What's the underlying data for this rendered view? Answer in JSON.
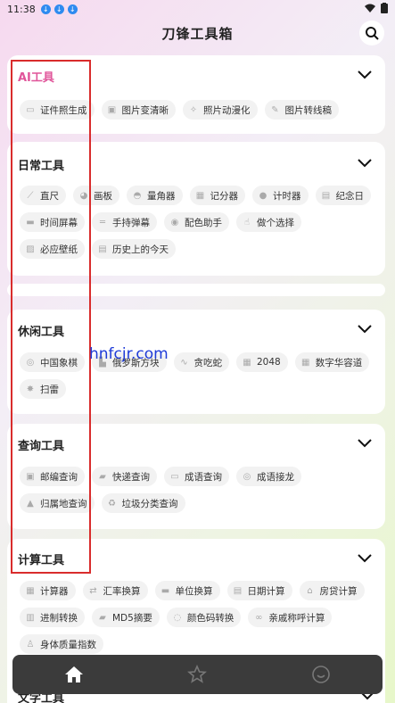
{
  "status_bar": {
    "time": "11:38"
  },
  "header": {
    "title": "刀锋工具箱"
  },
  "sections": [
    {
      "title": "AI工具",
      "items": [
        "证件照生成",
        "图片变清晰",
        "照片动漫化",
        "图片转线稿"
      ]
    },
    {
      "title": "日常工具",
      "items": [
        "直尺",
        "画板",
        "量角器",
        "记分器",
        "计时器",
        "纪念日",
        "时间屏幕",
        "手持弹幕",
        "配色助手",
        "做个选择",
        "必应壁纸",
        "历史上的今天"
      ]
    },
    {
      "title": "休闲工具",
      "items": [
        "中国象棋",
        "俄罗斯方块",
        "贪吃蛇",
        "2048",
        "数字华容道",
        "扫雷"
      ]
    },
    {
      "title": "查询工具",
      "items": [
        "邮编查询",
        "快递查询",
        "成语查询",
        "成语接龙",
        "归属地查询",
        "垃圾分类查询"
      ]
    },
    {
      "title": "计算工具",
      "items": [
        "计算器",
        "汇率换算",
        "单位换算",
        "日期计算",
        "房贷计算",
        "进制转换",
        "MD5摘要",
        "颜色码转换",
        "亲戚称呼计算",
        "身体质量指数"
      ]
    },
    {
      "title": "文字工具",
      "items": []
    }
  ],
  "watermark": "hnfcjr.com",
  "colors": {
    "accent": "#e0559a",
    "highlight": "#d92c2c",
    "nav_bg": "#3b3b3b"
  }
}
